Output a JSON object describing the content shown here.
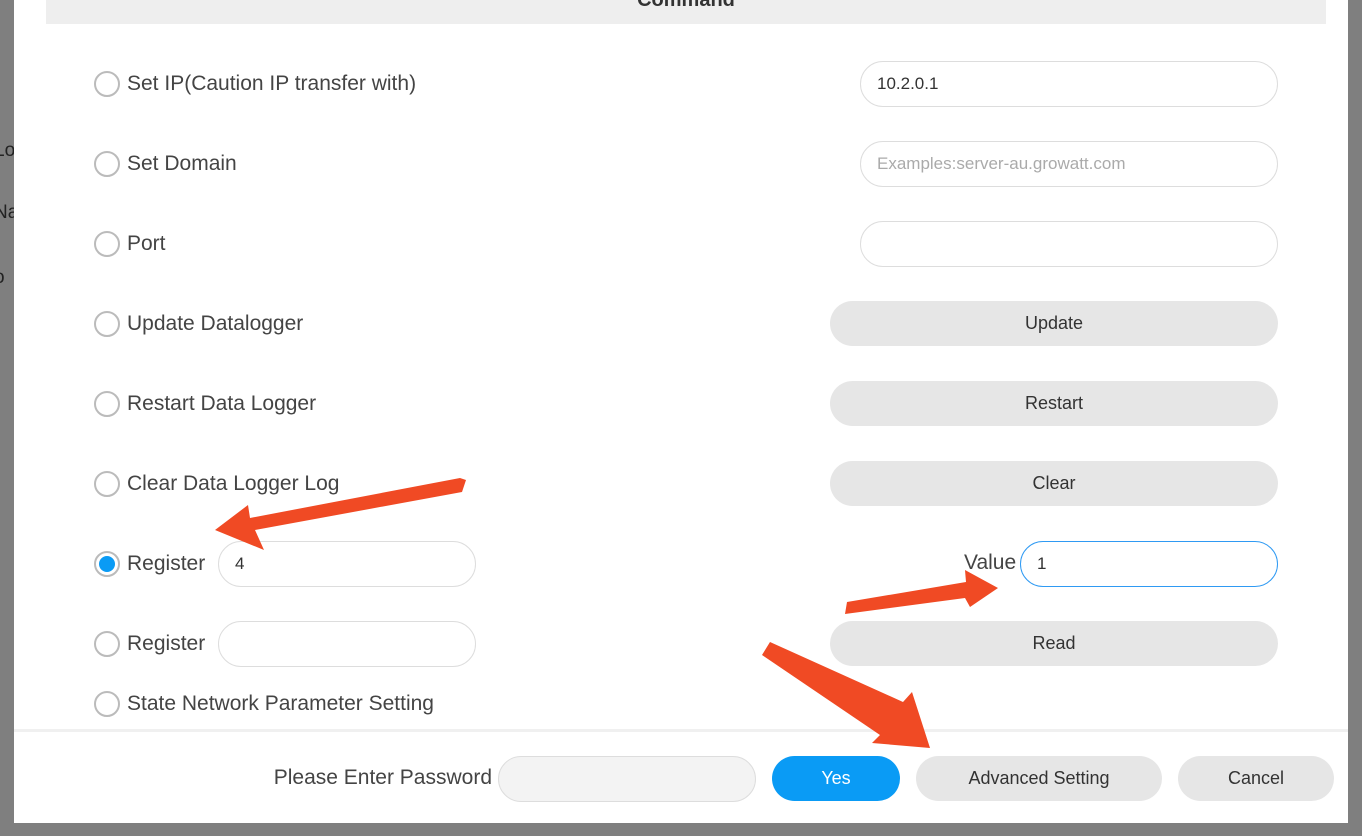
{
  "background": {
    "fragments": [
      "Lo",
      "Na",
      "o"
    ]
  },
  "dialog": {
    "title": "Command",
    "options": [
      {
        "label": "Set IP(Caution IP transfer with)",
        "selected": false,
        "input_value": "10.2.0.1"
      },
      {
        "label": "Set Domain",
        "selected": false,
        "input_placeholder": "Examples:server-au.growatt.com"
      },
      {
        "label": "Port",
        "selected": false,
        "input_value": ""
      },
      {
        "label": "Update Datalogger",
        "selected": false,
        "button": "Update"
      },
      {
        "label": "Restart Data Logger",
        "selected": false,
        "button": "Restart"
      },
      {
        "label": "Clear Data Logger Log",
        "selected": false,
        "button": "Clear"
      },
      {
        "label": "Register",
        "selected": true,
        "input_value": "4",
        "value_label": "Value",
        "value_input": "1"
      },
      {
        "label": "Register",
        "selected": false,
        "input_value": "",
        "button": "Read"
      },
      {
        "label": "State Network Parameter Setting",
        "selected": false
      }
    ],
    "footer": {
      "password_label": "Please Enter Password",
      "password_value": "",
      "yes": "Yes",
      "advanced": "Advanced Setting",
      "cancel": "Cancel"
    }
  },
  "colors": {
    "accent": "#0a9bf5",
    "annotation_arrow": "#f04a24"
  }
}
